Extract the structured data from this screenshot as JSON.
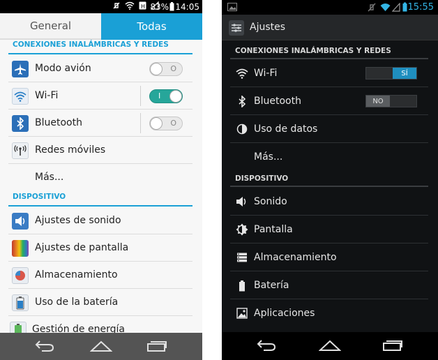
{
  "left_phone": {
    "status_bar": {
      "battery": "83%",
      "time": "14:05"
    },
    "tabs": {
      "general": "General",
      "todas": "Todas"
    },
    "section_wireless": "CONEXIONES INALÁMBRICAS Y REDES",
    "items_wireless": [
      {
        "label": "Modo avión",
        "switch": "off"
      },
      {
        "label": "Wi-Fi",
        "switch": "on",
        "switch_text": "I"
      },
      {
        "label": "Bluetooth",
        "switch": "off"
      },
      {
        "label": "Redes móviles"
      },
      {
        "label": "Más..."
      }
    ],
    "section_device": "DISPOSITIVO",
    "items_device": [
      {
        "label": "Ajustes de sonido"
      },
      {
        "label": "Ajustes de pantalla"
      },
      {
        "label": "Almacenamiento"
      },
      {
        "label": "Uso de la batería"
      },
      {
        "label": "Gestión de energía"
      }
    ],
    "colors": {
      "accent": "#1aa0d6",
      "switch_on": "#26a69a"
    }
  },
  "right_phone": {
    "status_bar": {
      "time": "15:55"
    },
    "app_title": "Ajustes",
    "section_wireless": "CONEXIONES INALÁMBRICAS Y REDES",
    "items_wireless": [
      {
        "label": "Wi-Fi",
        "switch": "on",
        "switch_text": "SÍ"
      },
      {
        "label": "Bluetooth",
        "switch": "off",
        "switch_text": "NO"
      },
      {
        "label": "Uso de datos"
      },
      {
        "label": "Más..."
      }
    ],
    "section_device": "DISPOSITIVO",
    "items_device": [
      {
        "label": "Sonido"
      },
      {
        "label": "Pantalla"
      },
      {
        "label": "Almacenamiento"
      },
      {
        "label": "Batería"
      },
      {
        "label": "Aplicaciones"
      }
    ],
    "colors": {
      "accent": "#33b5e5",
      "switch_on": "#1f8fbf"
    }
  },
  "nav_icons": [
    "back-icon",
    "home-icon",
    "recent-apps-icon"
  ]
}
